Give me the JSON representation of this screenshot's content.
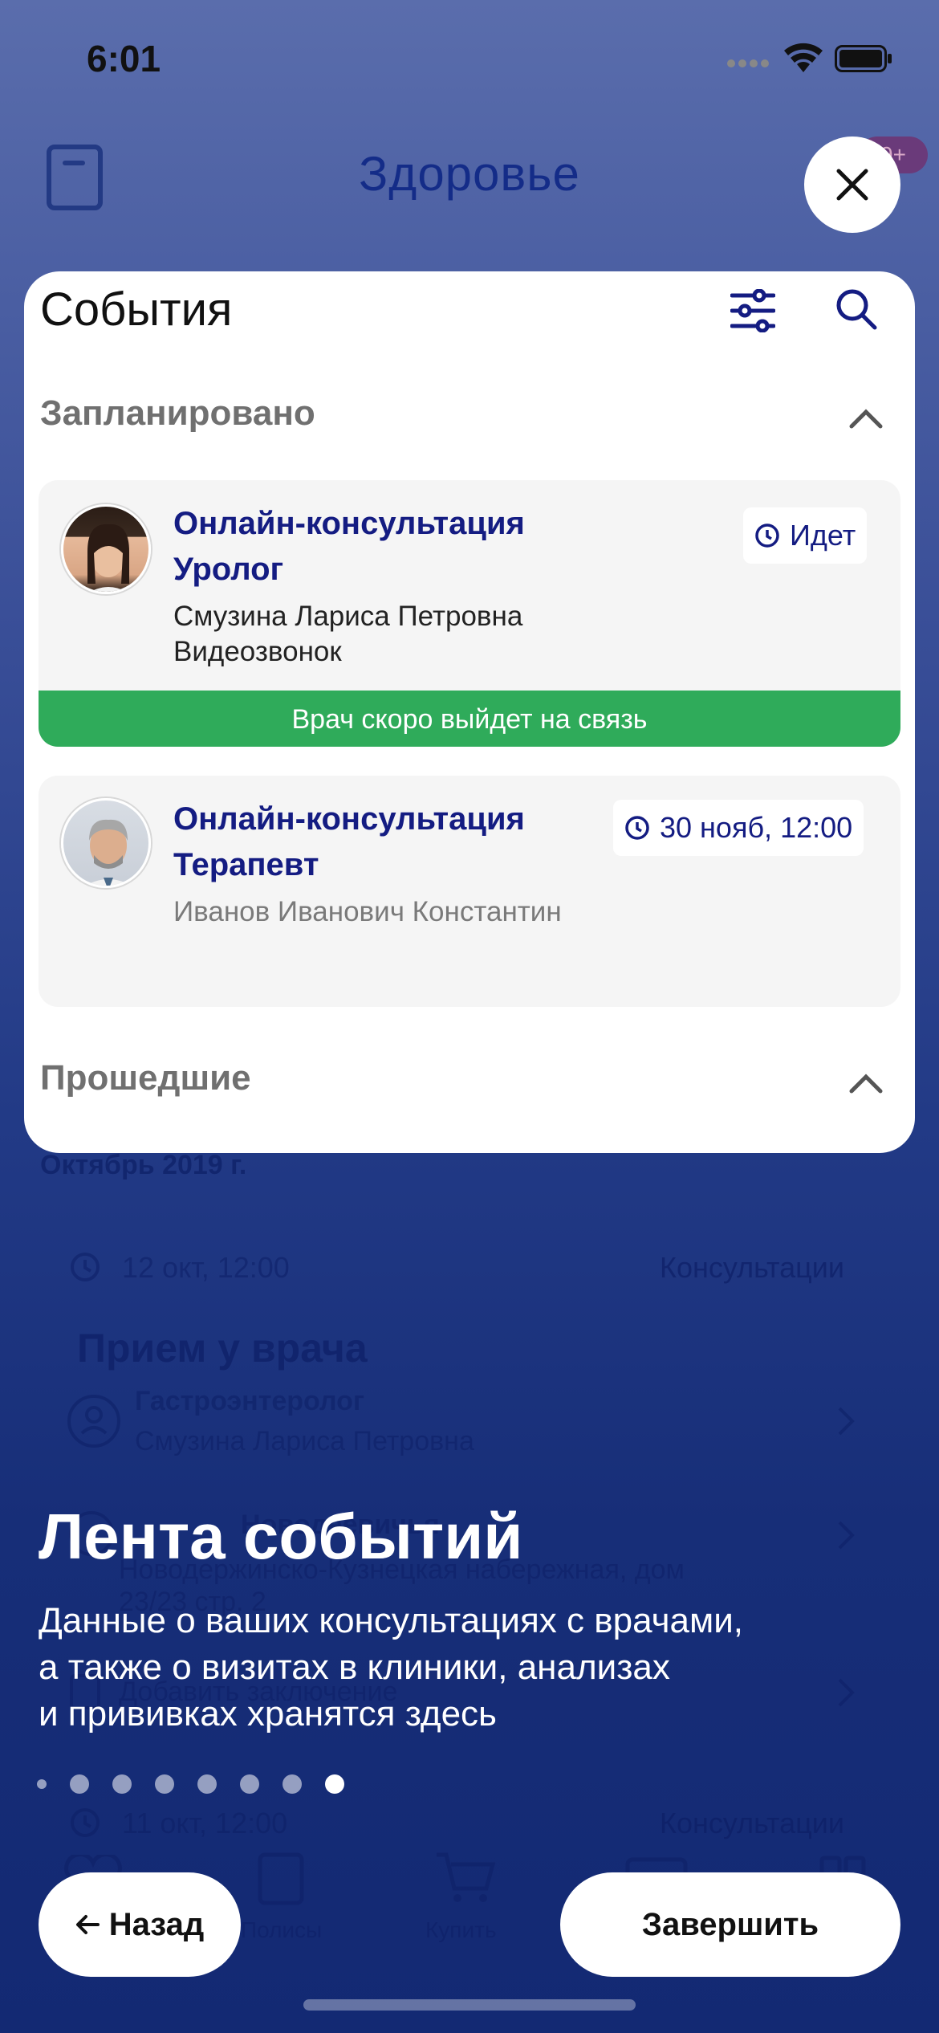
{
  "status": {
    "time": "6:01"
  },
  "background": {
    "header_title": "Здоровье",
    "badge": "9+",
    "month": "Октябрь 2019 г.",
    "row1": {
      "date": "12 окт, 12:00",
      "category": "Консультации"
    },
    "visit_title": "Прием у врача",
    "doctor_role": "Гастроэнтеролог",
    "doctor_name": "Смузина Лариса Петровна",
    "address_line1": "Новодеевичья",
    "address_line2": "Новодержинско-Кузнецкая набережная, дом",
    "address_line3": "23/23 стр. 2",
    "add_report": "Добавить заключение",
    "row2": {
      "date": "11 окт, 12:00",
      "category": "Консультации"
    },
    "tabs": [
      "Полисы",
      "Купить"
    ]
  },
  "card": {
    "title": "События",
    "planned_title": "Запланировано",
    "past_title": "Прошедшие",
    "events": [
      {
        "title_line1": "Онлайн-консультация",
        "title_line2": "Уролог",
        "doctor": "Смузина Лариса Петровна",
        "type": "Видеозвонок",
        "status": "Идет",
        "banner": "Врач скоро выйдет на связь"
      },
      {
        "title_line1": "Онлайн-консультация",
        "title_line2": "Терапевт",
        "doctor": "Иванов Иванович Константин",
        "time": "30 нояб, 12:00"
      }
    ]
  },
  "onboarding": {
    "title": "Лента событий",
    "description_lines": [
      "Данные о ваших консультациях с врачами,",
      "а также о визитах в клиники, анализах",
      "и прививках хранятся здесь"
    ],
    "page_count": 8,
    "active_page": 8,
    "back_label": "Назад",
    "finish_label": "Завершить"
  },
  "colors": {
    "accent": "#141c82",
    "green": "#2fab5a",
    "background_top": "#5a6dac",
    "background_bottom": "#132973"
  }
}
